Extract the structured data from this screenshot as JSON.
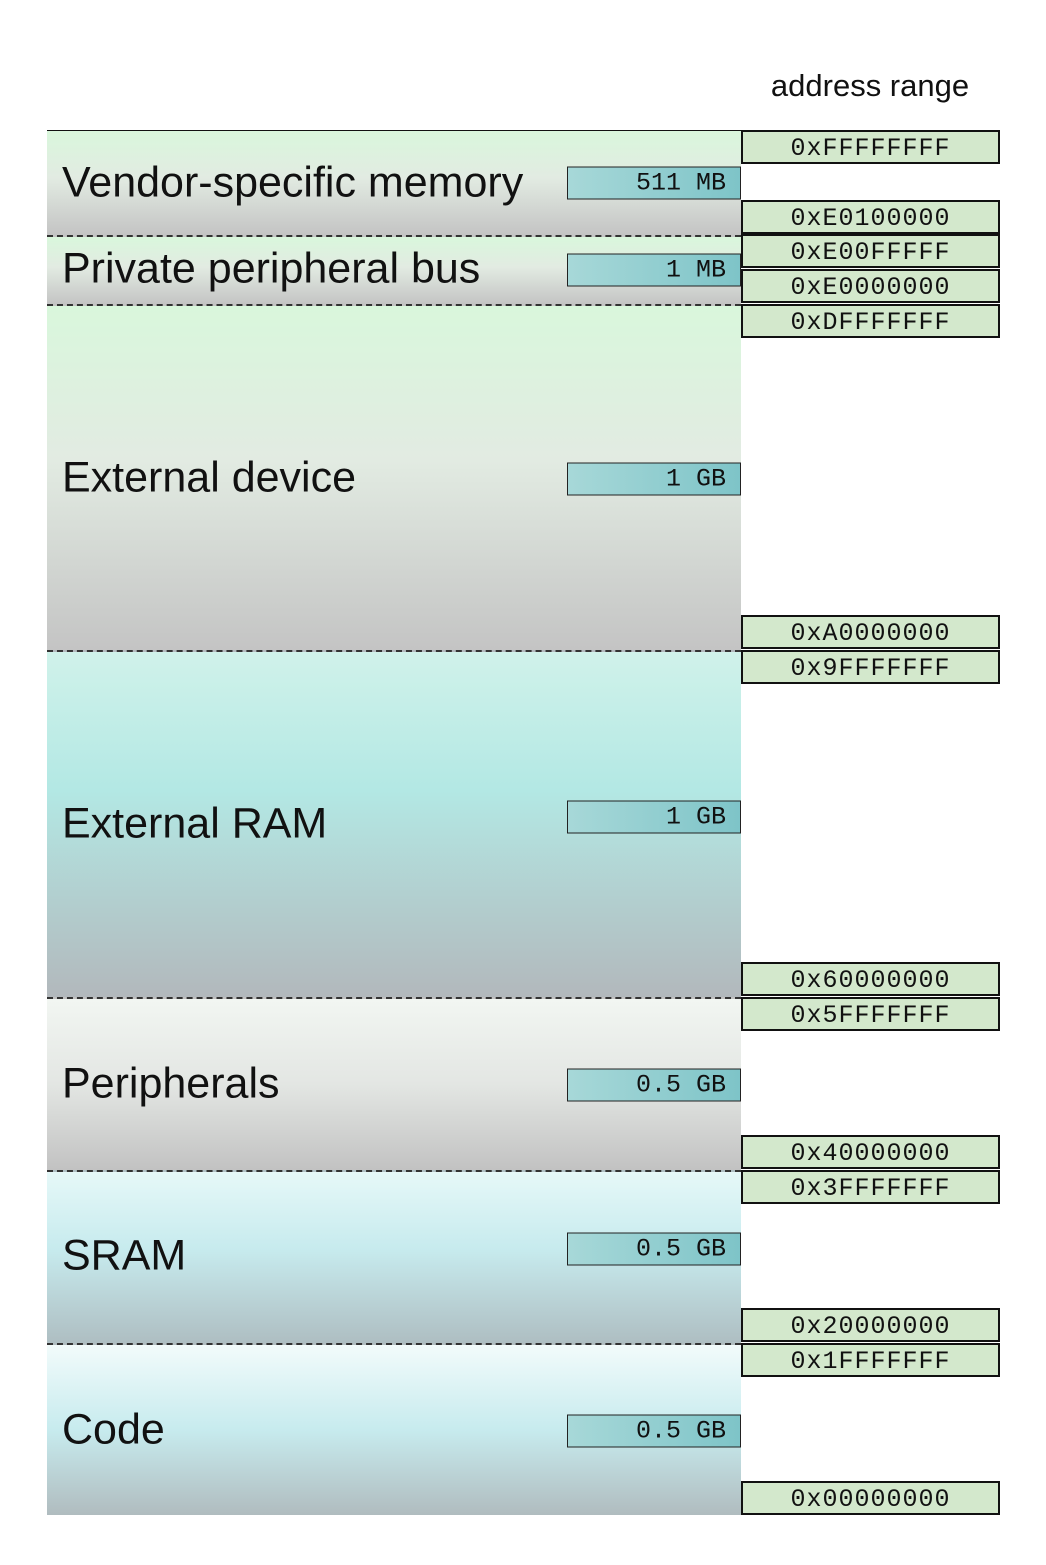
{
  "header": "address range",
  "regions": [
    {
      "label": "Vendor-specific memory",
      "size": "511 MB",
      "addr_high": "0xFFFFFFFF",
      "addr_low": "0xE0100000"
    },
    {
      "label": "Private peripheral bus",
      "size": "1 MB",
      "addr_high": "0xE00FFFFF",
      "addr_low": "0xE0000000"
    },
    {
      "label": "External device",
      "size": "1 GB",
      "addr_high": "0xDFFFFFFF",
      "addr_low": "0xA0000000"
    },
    {
      "label": "External RAM",
      "size": "1 GB",
      "addr_high": "0x9FFFFFFF",
      "addr_low": "0x60000000"
    },
    {
      "label": "Peripherals",
      "size": "0.5 GB",
      "addr_high": "0x5FFFFFFF",
      "addr_low": "0x40000000"
    },
    {
      "label": "SRAM",
      "size": "0.5 GB",
      "addr_high": "0x3FFFFFFF",
      "addr_low": "0x20000000"
    },
    {
      "label": "Code",
      "size": "0.5 GB",
      "addr_high": "0x1FFFFFFF",
      "addr_low": "0x00000000"
    }
  ]
}
